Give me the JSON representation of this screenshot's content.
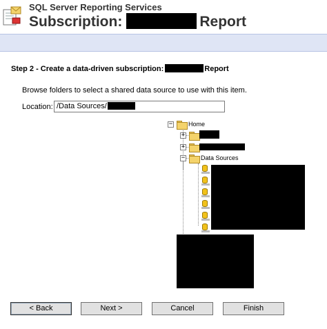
{
  "header": {
    "app_title": "SQL Server Reporting Services",
    "page_title_prefix": "Subscription:",
    "page_title_suffix": "Report"
  },
  "step": {
    "heading_prefix": "Step 2 - Create a data-driven subscription:",
    "heading_suffix": "Report"
  },
  "instructions": "Browse folders to select a shared data source to use with this item.",
  "location": {
    "label": "Location:",
    "value": "/Data Sources/"
  },
  "tree": {
    "root": {
      "label": "Home",
      "expander": "−"
    },
    "folders": [
      {
        "label": "",
        "expander": "+"
      },
      {
        "label": "",
        "expander": "+"
      },
      {
        "label": "Data Sources",
        "expander": "−"
      }
    ],
    "data_source_count": 6
  },
  "buttons": {
    "back": "< Back",
    "next": "Next >",
    "cancel": "Cancel",
    "finish": "Finish"
  },
  "colors": {
    "band": "#dfe5f5",
    "title": "#333333"
  }
}
